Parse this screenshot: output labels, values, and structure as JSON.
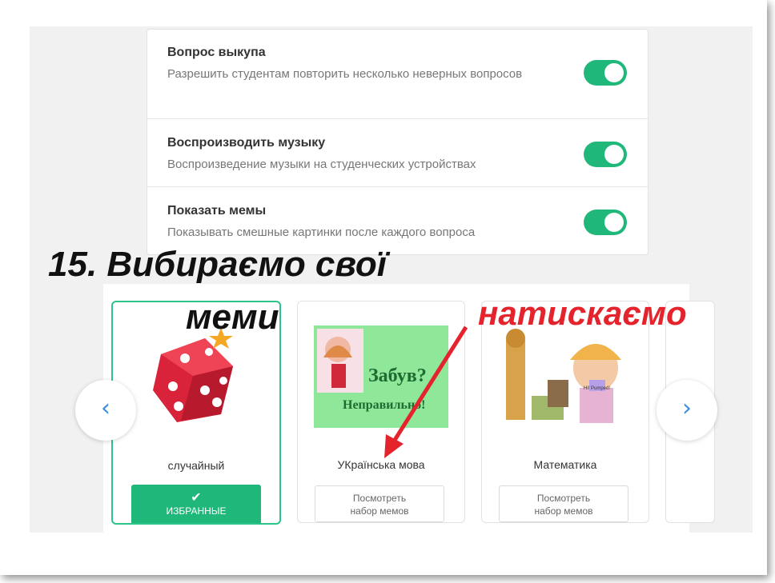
{
  "settings": [
    {
      "title": "Вопрос выкупа",
      "desc": "Разрешить студентам повторить несколько неверных вопросов",
      "enabled": true
    },
    {
      "title": "Воспроизводить музыку",
      "desc": "Воспроизведение музыки на студенческих устройствах",
      "enabled": true
    },
    {
      "title": "Показать мемы",
      "desc": "Показывать смешные картинки после каждого вопроса",
      "enabled": true
    }
  ],
  "annotation": {
    "line1": "15. Вибираємо свої",
    "line2": "меми",
    "click_note": "натискаємо"
  },
  "memes": {
    "cards": [
      {
        "name": "случайный",
        "selected": true,
        "button": "ИЗБРАННЫЕ"
      },
      {
        "name": "УКраїнська мова",
        "selected": false,
        "button_line1": "Посмотреть",
        "button_line2": "набор мемов",
        "image_text1": "Забув?",
        "image_text2": "Неправильно!"
      },
      {
        "name": "Математика",
        "selected": false,
        "button_line1": "Посмотреть",
        "button_line2": "набор мемов",
        "image_text": "Hi! Pumped!"
      }
    ],
    "accent_color": "#20b87a",
    "icons": {
      "prev": "chevron-left-icon",
      "next": "chevron-right-icon",
      "check": "check-icon"
    }
  }
}
